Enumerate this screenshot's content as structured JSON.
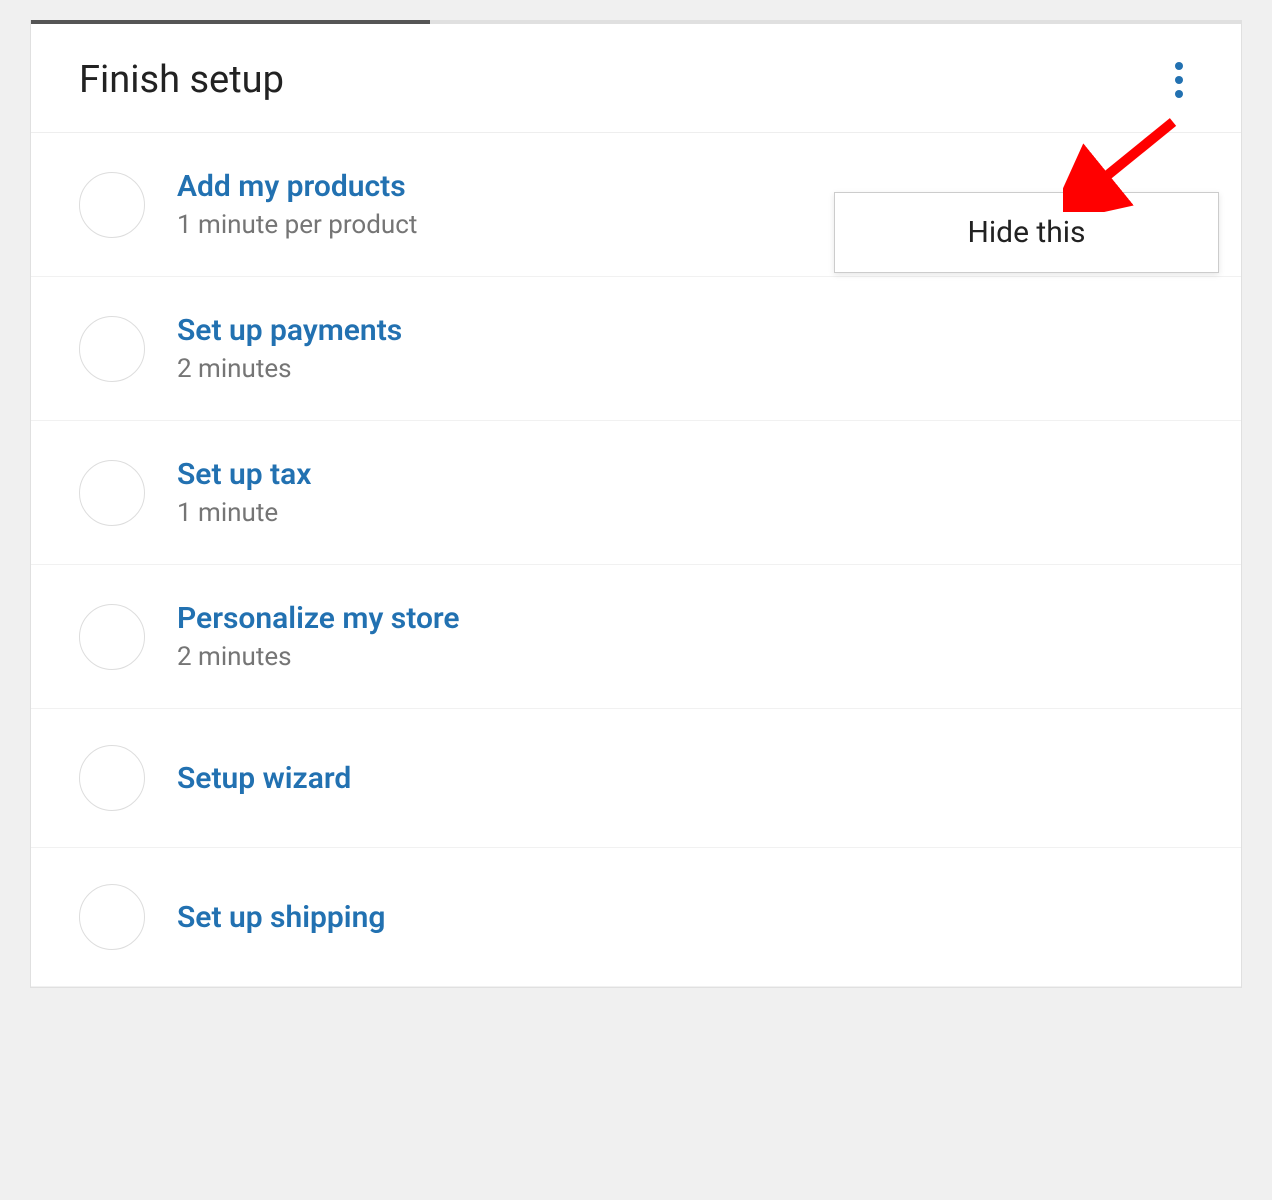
{
  "header": {
    "title": "Finish setup",
    "progress_percent": 33
  },
  "popover": {
    "hide_label": "Hide this"
  },
  "tasks": [
    {
      "title": "Add my products",
      "subtitle": "1 minute per product"
    },
    {
      "title": "Set up payments",
      "subtitle": "2 minutes"
    },
    {
      "title": "Set up tax",
      "subtitle": "1 minute"
    },
    {
      "title": "Personalize my store",
      "subtitle": "2 minutes"
    },
    {
      "title": "Setup wizard",
      "subtitle": ""
    },
    {
      "title": "Set up shipping",
      "subtitle": ""
    }
  ],
  "colors": {
    "link": "#2271b1",
    "muted": "#757575",
    "arrow": "#ff0000"
  }
}
